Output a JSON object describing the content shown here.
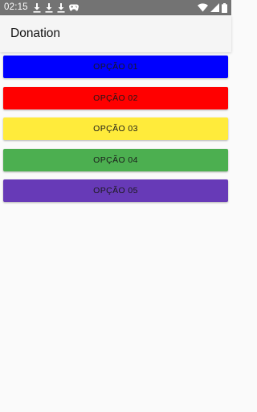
{
  "status_bar": {
    "time": "02:15",
    "left_icons": [
      "download-icon",
      "download-icon",
      "download-icon",
      "gamepad-icon"
    ],
    "right_icons": [
      "wifi-icon",
      "signal-icon",
      "battery-icon"
    ]
  },
  "app_bar": {
    "title": "Donation"
  },
  "options": [
    {
      "label": "OPÇÃO 01",
      "color": "#0000ff"
    },
    {
      "label": "OPÇÃO 02",
      "color": "#ff0000"
    },
    {
      "label": "OPÇÃO 03",
      "color": "#ffeb3b"
    },
    {
      "label": "OPÇÃO 04",
      "color": "#4caf50"
    },
    {
      "label": "OPÇÃO 05",
      "color": "#673ab7"
    }
  ]
}
